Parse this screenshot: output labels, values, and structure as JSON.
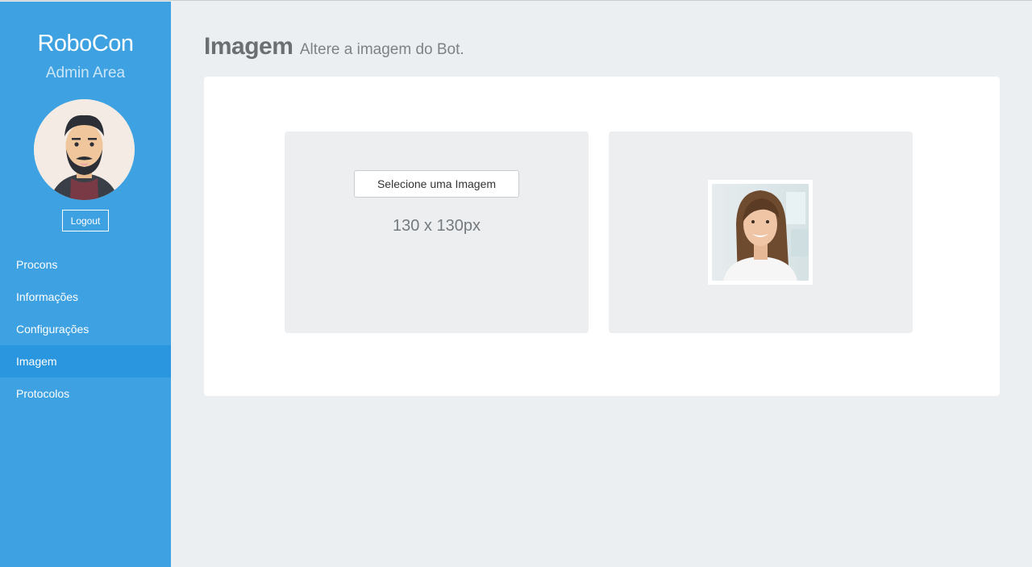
{
  "sidebar": {
    "brand": "RoboCon",
    "subtitle": "Admin Area",
    "logout_label": "Logout",
    "items": [
      {
        "label": "Procons"
      },
      {
        "label": "Informações"
      },
      {
        "label": "Configurações"
      },
      {
        "label": "Imagem",
        "active": true
      },
      {
        "label": "Protocolos"
      }
    ]
  },
  "header": {
    "title": "Imagem",
    "subtitle": "Altere a imagem do Bot."
  },
  "upload": {
    "button_label": "Selecione uma Imagem",
    "size_hint": "130 x 130px"
  },
  "icons": {
    "user_avatar": "bearded-man-avatar",
    "bot_image": "woman-portrait-photo"
  },
  "colors": {
    "sidebar": "#3ea1e2",
    "sidebar_active": "#2996df",
    "background": "#eceff1"
  }
}
